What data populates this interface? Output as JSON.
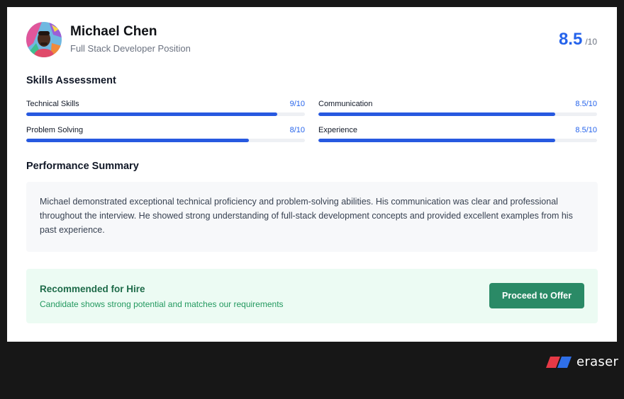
{
  "candidate": {
    "name": "Michael Chen",
    "position": "Full Stack Developer Position",
    "score": "8.5",
    "score_max": "/10"
  },
  "skills": {
    "title": "Skills Assessment",
    "items": [
      {
        "label": "Technical Skills",
        "score": "9/10",
        "level": 0.9
      },
      {
        "label": "Communication",
        "score": "8.5/10",
        "level": 0.85
      },
      {
        "label": "Problem Solving",
        "score": "8/10",
        "level": 0.8
      },
      {
        "label": "Experience",
        "score": "8.5/10",
        "level": 0.85
      }
    ]
  },
  "summary": {
    "title": "Performance Summary",
    "text": "Michael demonstrated exceptional technical proficiency and problem-solving abilities. His communication was clear and professional throughout the interview. He showed strong understanding of full-stack development concepts and provided excellent examples from his past experience."
  },
  "recommendation": {
    "title": "Recommended for Hire",
    "subtitle": "Candidate shows strong potential and matches our requirements",
    "button_label": "Proceed to Offer"
  },
  "branding": {
    "wordmark": "eraser"
  },
  "colors": {
    "accent": "#2563eb",
    "success": "#2a8a66",
    "background": "#171717"
  },
  "icons": {
    "avatar": "candidate-avatar",
    "logo": "eraser-logo-icon"
  }
}
